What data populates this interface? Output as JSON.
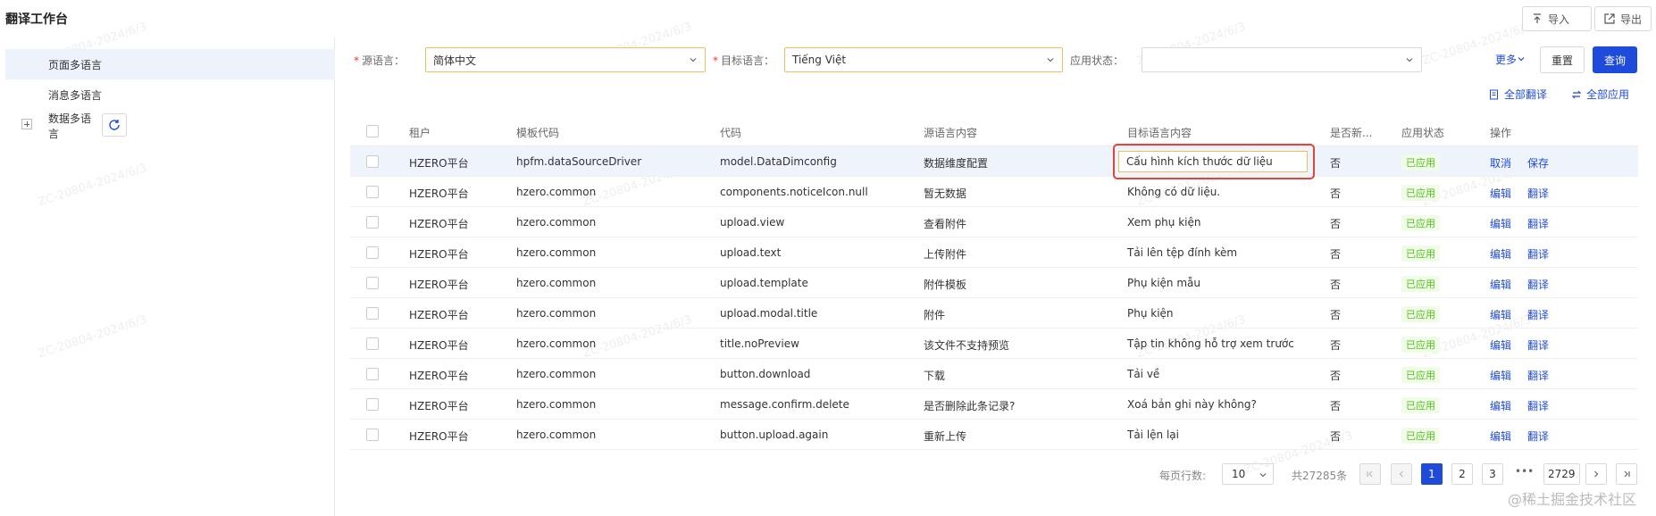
{
  "page_title": "翻译工作台",
  "top_actions": {
    "import": "导入",
    "export": "导出"
  },
  "sidebar": {
    "items": [
      {
        "label": "页面多语言",
        "active": true
      },
      {
        "label": "消息多语言",
        "active": false
      },
      {
        "label": "数据多语言",
        "active": false
      }
    ]
  },
  "filters": {
    "source_lang_label": "源语言：",
    "source_lang_value": "简体中文",
    "target_lang_label": "目标语言：",
    "target_lang_value": "Tiếng Việt",
    "apply_status_label": "应用状态：",
    "apply_status_value": "",
    "more": "更多",
    "reset": "重置",
    "query": "查询"
  },
  "toolbar": {
    "translate_all": "全部翻译",
    "apply_all": "全部应用"
  },
  "table": {
    "headers": [
      "租户",
      "模板代码",
      "代码",
      "源语言内容",
      "目标语言内容",
      "是否新...",
      "应用状态",
      "操作"
    ],
    "rows": [
      {
        "tenant": "HZERO平台",
        "template": "hpfm.dataSourceDriver",
        "code": "model.DataDimconfig",
        "source": "数据维度配置",
        "target": "Cấu hình kích thước dữ liệu",
        "is_new": "否",
        "status": "已应用",
        "action1": "取消",
        "action2": "保存",
        "editing": true
      },
      {
        "tenant": "HZERO平台",
        "template": "hzero.common",
        "code": "components.noticeIcon.null",
        "source": "暂无数据",
        "target": "Không có dữ liệu.",
        "is_new": "否",
        "status": "已应用",
        "action1": "编辑",
        "action2": "翻译"
      },
      {
        "tenant": "HZERO平台",
        "template": "hzero.common",
        "code": "upload.view",
        "source": "查看附件",
        "target": "Xem phụ kiện",
        "is_new": "否",
        "status": "已应用",
        "action1": "编辑",
        "action2": "翻译"
      },
      {
        "tenant": "HZERO平台",
        "template": "hzero.common",
        "code": "upload.text",
        "source": "上传附件",
        "target": "Tải lên tệp đính kèm",
        "is_new": "否",
        "status": "已应用",
        "action1": "编辑",
        "action2": "翻译"
      },
      {
        "tenant": "HZERO平台",
        "template": "hzero.common",
        "code": "upload.template",
        "source": "附件模板",
        "target": "Phụ kiện mẫu",
        "is_new": "否",
        "status": "已应用",
        "action1": "编辑",
        "action2": "翻译"
      },
      {
        "tenant": "HZERO平台",
        "template": "hzero.common",
        "code": "upload.modal.title",
        "source": "附件",
        "target": "Phụ kiện",
        "is_new": "否",
        "status": "已应用",
        "action1": "编辑",
        "action2": "翻译"
      },
      {
        "tenant": "HZERO平台",
        "template": "hzero.common",
        "code": "title.noPreview",
        "source": "该文件不支持预览",
        "target": "Tập tin không hỗ trợ xem trước",
        "is_new": "否",
        "status": "已应用",
        "action1": "编辑",
        "action2": "翻译"
      },
      {
        "tenant": "HZERO平台",
        "template": "hzero.common",
        "code": "button.download",
        "source": "下载",
        "target": "Tải về",
        "is_new": "否",
        "status": "已应用",
        "action1": "编辑",
        "action2": "翻译"
      },
      {
        "tenant": "HZERO平台",
        "template": "hzero.common",
        "code": "message.confirm.delete",
        "source": "是否删除此条记录?",
        "target": "Xoá bản ghi này không?",
        "is_new": "否",
        "status": "已应用",
        "action1": "编辑",
        "action2": "翻译"
      },
      {
        "tenant": "HZERO平台",
        "template": "hzero.common",
        "code": "button.upload.again",
        "source": "重新上传",
        "target": "Tải lện lại",
        "is_new": "否",
        "status": "已应用",
        "action1": "编辑",
        "action2": "翻译"
      }
    ]
  },
  "pagination": {
    "page_size_label": "每页行数:",
    "page_size": "10",
    "total": "共27285条",
    "pages": [
      "1",
      "2",
      "3"
    ],
    "current": "1",
    "ellipsis": "•••",
    "last_page": "2729"
  },
  "watermark_text": "ZC-20804-2024/6/3",
  "credit": "@稀土掘金技术社区",
  "colors": {
    "primary": "#1f4bdb",
    "success": "#52c41a",
    "highlight": "#e0443a",
    "required": "#e53935"
  }
}
